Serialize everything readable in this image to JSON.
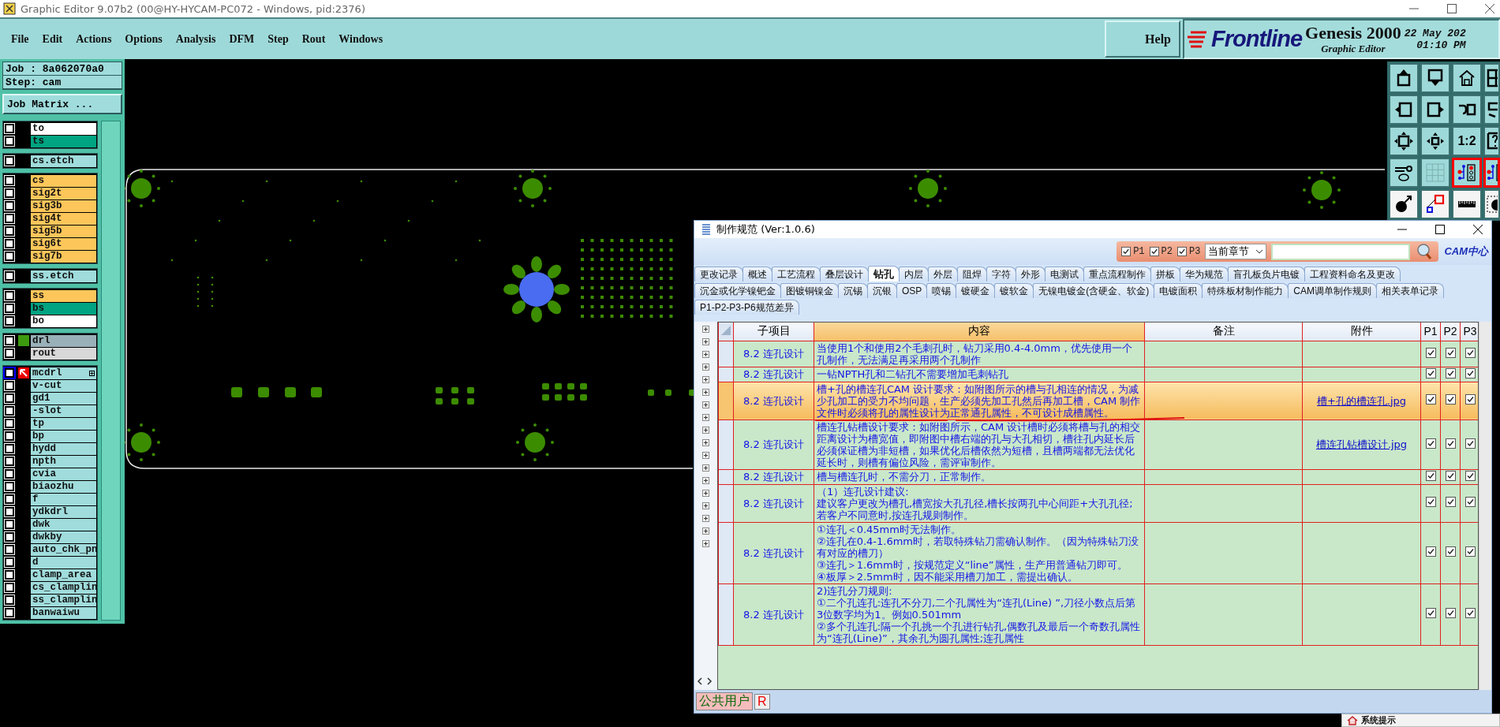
{
  "window": {
    "title": "Graphic Editor 9.07b2 (00@HY-HYCAM-PC072 - Windows, pid:2376)"
  },
  "menu": [
    "File",
    "Edit",
    "Actions",
    "Options",
    "Analysis",
    "DFM",
    "Step",
    "Rout",
    "Windows"
  ],
  "help": "Help",
  "logo": {
    "brand": "Frontline",
    "product": "Genesis 2000",
    "subtitle": "Graphic Editor",
    "date": "22 May 202",
    "time": "01:10 PM"
  },
  "job_line": "Job : 8a062070a0",
  "step_line": "Step: cam",
  "job_matrix_button": "Job Matrix ...",
  "layer_groups": [
    [
      {
        "name": "to",
        "color": "#ffffff",
        "checked": false,
        "selected": false,
        "affected": false
      },
      {
        "name": "ts",
        "color": "#00a382",
        "checked": false,
        "selected": false,
        "affected": false
      }
    ],
    [
      {
        "name": "cs.etch",
        "color": "#a0dcdc",
        "checked": false,
        "selected": false,
        "affected": false
      }
    ],
    [
      {
        "name": "cs",
        "color": "#fcc65a",
        "checked": false,
        "selected": false,
        "affected": false
      },
      {
        "name": "sig2t",
        "color": "#fcc65a",
        "checked": false,
        "selected": false,
        "affected": false
      },
      {
        "name": "sig3b",
        "color": "#fcc65a",
        "checked": false,
        "selected": false,
        "affected": false
      },
      {
        "name": "sig4t",
        "color": "#fcc65a",
        "checked": false,
        "selected": false,
        "affected": false
      },
      {
        "name": "sig5b",
        "color": "#fcc65a",
        "checked": false,
        "selected": false,
        "affected": false
      },
      {
        "name": "sig6t",
        "color": "#fcc65a",
        "checked": false,
        "selected": false,
        "affected": false
      },
      {
        "name": "sig7b",
        "color": "#fcc65a",
        "checked": false,
        "selected": false,
        "affected": false
      }
    ],
    [
      {
        "name": "ss.etch",
        "color": "#a0dcdc",
        "checked": false,
        "selected": false,
        "affected": false
      }
    ],
    [
      {
        "name": "ss",
        "color": "#fcc65a",
        "checked": false,
        "selected": false,
        "affected": false
      },
      {
        "name": "bs",
        "color": "#00a382",
        "checked": false,
        "selected": false,
        "affected": false
      },
      {
        "name": "bo",
        "color": "#ffffff",
        "checked": false,
        "selected": false,
        "affected": false
      }
    ],
    [
      {
        "name": "drl",
        "color": "#9ab0b8",
        "checked": false,
        "selected": false,
        "affected": true
      },
      {
        "name": "rout",
        "color": "#d8d8d8",
        "checked": false,
        "selected": false,
        "affected": false
      }
    ],
    [
      {
        "name": "mcdrl",
        "color": "#a0dcdc",
        "checked": false,
        "selected": true,
        "affected": false
      },
      {
        "name": "v-cut",
        "color": "#a0dcdc",
        "checked": false,
        "selected": false,
        "affected": false
      },
      {
        "name": "gd1",
        "color": "#a0dcdc",
        "checked": false,
        "selected": false,
        "affected": false
      },
      {
        "name": "-slot",
        "color": "#a0dcdc",
        "checked": false,
        "selected": false,
        "affected": false
      },
      {
        "name": "tp",
        "color": "#a0dcdc",
        "checked": false,
        "selected": false,
        "affected": false
      },
      {
        "name": "bp",
        "color": "#a0dcdc",
        "checked": false,
        "selected": false,
        "affected": false
      },
      {
        "name": "hydd",
        "color": "#a0dcdc",
        "checked": false,
        "selected": false,
        "affected": false
      },
      {
        "name": "npth",
        "color": "#a0dcdc",
        "checked": false,
        "selected": false,
        "affected": false
      },
      {
        "name": "cvia",
        "color": "#a0dcdc",
        "checked": false,
        "selected": false,
        "affected": false
      },
      {
        "name": "biaozhu",
        "color": "#a0dcdc",
        "checked": false,
        "selected": false,
        "affected": false
      },
      {
        "name": "f",
        "color": "#a0dcdc",
        "checked": false,
        "selected": false,
        "affected": false
      },
      {
        "name": "ydkdrl",
        "color": "#a0dcdc",
        "checked": false,
        "selected": false,
        "affected": false
      },
      {
        "name": "dwk",
        "color": "#a0dcdc",
        "checked": false,
        "selected": false,
        "affected": false
      },
      {
        "name": "dwkby",
        "color": "#a0dcdc",
        "checked": false,
        "selected": false,
        "affected": false
      },
      {
        "name": "auto_chk_pn",
        "color": "#a0dcdc",
        "checked": false,
        "selected": false,
        "affected": false
      },
      {
        "name": "d",
        "color": "#a0dcdc",
        "checked": false,
        "selected": false,
        "affected": false
      },
      {
        "name": "clamp_area",
        "color": "#a0dcdc",
        "checked": false,
        "selected": false,
        "affected": false
      },
      {
        "name": "cs_clamplin",
        "color": "#a0dcdc",
        "checked": false,
        "selected": false,
        "affected": false
      },
      {
        "name": "ss_clamplin",
        "color": "#a0dcdc",
        "checked": false,
        "selected": false,
        "affected": false
      },
      {
        "name": "banwaiwu",
        "color": "#a0dcdc",
        "checked": false,
        "selected": false,
        "affected": false
      }
    ]
  ],
  "toolbar_buttons": [
    {
      "kind": "box-up",
      "active": false
    },
    {
      "kind": "box-down",
      "active": false
    },
    {
      "kind": "house",
      "active": false
    },
    {
      "kind": "window",
      "active": false
    },
    {
      "kind": "box-left",
      "active": false
    },
    {
      "kind": "box-right",
      "active": false
    },
    {
      "kind": "undo",
      "active": false
    },
    {
      "kind": "bracket",
      "active": false
    },
    {
      "kind": "expand",
      "active": false
    },
    {
      "kind": "move",
      "active": false
    },
    {
      "kind": "ratio",
      "label": "1:2",
      "active": false
    },
    {
      "kind": "question",
      "active": false
    },
    {
      "kind": "tools",
      "active": false
    },
    {
      "kind": "grid",
      "active": false
    },
    {
      "kind": "circuit",
      "active": true
    },
    {
      "kind": "circuit",
      "active": true
    },
    {
      "kind": "ball",
      "active": false
    },
    {
      "kind": "shapes",
      "active": false
    },
    {
      "kind": "ruler",
      "active": false
    },
    {
      "kind": "dot",
      "active": false
    }
  ],
  "dialog": {
    "title": "制作规范 (Ver:1.0.6)",
    "filters": [
      {
        "label": "P1",
        "checked": true
      },
      {
        "label": "P2",
        "checked": true
      },
      {
        "label": "P3",
        "checked": true
      }
    ],
    "chapter_select": "当前章节",
    "logo": "CAM中心",
    "tab_rows": [
      [
        {
          "label": "更改记录",
          "selected": false
        },
        {
          "label": "概述",
          "selected": false
        },
        {
          "label": "工艺流程",
          "selected": false
        },
        {
          "label": "叠层设计",
          "selected": false
        },
        {
          "label": "钻孔",
          "selected": true
        },
        {
          "label": "内层",
          "selected": false
        },
        {
          "label": "外层",
          "selected": false
        },
        {
          "label": "阻焊",
          "selected": false
        },
        {
          "label": "字符",
          "selected": false
        },
        {
          "label": "外形",
          "selected": false
        },
        {
          "label": "电测试",
          "selected": false
        },
        {
          "label": "重点流程制作",
          "selected": false
        },
        {
          "label": "拼板",
          "selected": false
        },
        {
          "label": "华为规范",
          "selected": false
        },
        {
          "label": "盲孔板负片电镀",
          "selected": false
        },
        {
          "label": "工程资料命名及更改",
          "selected": false
        }
      ],
      [
        {
          "label": "沉金或化学镍钯金",
          "selected": false
        },
        {
          "label": "图镀铜镍金",
          "selected": false
        },
        {
          "label": "沉锡",
          "selected": false
        },
        {
          "label": "沉银",
          "selected": false
        },
        {
          "label": "OSP",
          "selected": false
        },
        {
          "label": "喷锡",
          "selected": false
        },
        {
          "label": "镀硬金",
          "selected": false
        },
        {
          "label": "镀软金",
          "selected": false
        },
        {
          "label": "无镍电镀金(含硬金、软金)",
          "selected": false
        },
        {
          "label": "电镀面积",
          "selected": false
        },
        {
          "label": "特殊板材制作能力",
          "selected": false
        },
        {
          "label": "CAM调单制作规则",
          "selected": false
        },
        {
          "label": "相关表单记录",
          "selected": false
        }
      ],
      [
        {
          "label": "P1-P2-P3-P6规范差异",
          "selected": false
        }
      ]
    ],
    "columns": [
      {
        "label": "子项目",
        "selected": false
      },
      {
        "label": "内容",
        "selected": true
      },
      {
        "label": "备注",
        "selected": false
      },
      {
        "label": "附件",
        "selected": false
      },
      {
        "label": "P1",
        "selected": false
      },
      {
        "label": "P2",
        "selected": false
      },
      {
        "label": "P3",
        "selected": false
      }
    ],
    "rows": [
      {
        "sub_item": "8.2 连孔设计",
        "content": "当使用1个和使用2个毛刺孔时，钻刀采用0.4-4.0mm，优先使用一个孔制作，无法满足再采用两个孔制作",
        "selected": false,
        "flags": [
          true,
          true,
          true
        ]
      },
      {
        "sub_item": "8.2 连孔设计",
        "content": "一钻NPTH孔和二钻孔不需要增加毛刺钻孔",
        "selected": false,
        "flags": [
          true,
          true,
          true
        ]
      },
      {
        "sub_item": "8.2 连孔设计",
        "content": "槽+孔的槽连孔CAM 设计要求：如附图所示的槽与孔相连的情况，为减少孔加工的受力不均问题，生产必须先加工孔然后再加工槽，CAM 制作文件时必须将孔的属性设计为正常通孔属性，不可设计成槽属性。",
        "attachment": "槽+孔的槽连孔.jpg",
        "selected": true,
        "flags": [
          true,
          true,
          true
        ]
      },
      {
        "sub_item": "8.2 连孔设计",
        "content": "槽连孔钻槽设计要求：如附图所示，CAM 设计槽时必须将槽与孔的相交距离设计为槽宽值，即附图中槽右端的孔与大孔相切，槽往孔内延长后必须保证槽为非短槽，如果优化后槽依然为短槽，且槽两端都无法优化延长时，则槽有偏位风险，需评审制作。",
        "attachment": "槽连孔钻槽设计.jpg",
        "selected": false,
        "flags": [
          true,
          true,
          true
        ]
      },
      {
        "sub_item": "8.2 连孔设计",
        "content": "槽与槽连孔时，不需分刀，正常制作。",
        "selected": false,
        "flags": [
          true,
          true,
          true
        ]
      },
      {
        "sub_item": "8.2 连孔设计",
        "content": "（1）连孔设计建议:\n建议客户更改为槽孔,槽宽按大孔孔径,槽长按两孔中心间距+大孔孔径;若客户不同意时,按连孔规则制作。",
        "selected": false,
        "flags": [
          true,
          true,
          true
        ]
      },
      {
        "sub_item": "8.2 连孔设计",
        "content": "①连孔＜0.45mm时无法制作。\n②连孔在0.4-1.6mm时，若取特殊钻刀需确认制作。（因为特殊钻刀没有对应的槽刀）\n③连孔＞1.6mm时，按规范定义“line”属性，生产用普通钻刀即可。\n④板厚＞2.5mm时，因不能采用槽刀加工，需提出确认。",
        "selected": false,
        "flags": [
          true,
          true,
          true
        ]
      },
      {
        "sub_item": "8.2 连孔设计",
        "content": "2)连孔分刀规则:\n①二个孔连孔:连孔不分刀,二个孔属性为“连孔(Line) ”,刀径小数点后第3位数字均为1。例如0.501mm\n②多个孔连孔:隔一个孔挑一个孔进行钻孔,偶数孔及最后一个奇数孔属性为“连孔(Line)”，其余孔为圆孔属性;连孔属性",
        "selected": false,
        "flags": [
          true,
          true,
          true
        ]
      }
    ],
    "status": {
      "user": "公共用户",
      "role": "R"
    }
  },
  "popup": {
    "title": "系统提示"
  }
}
